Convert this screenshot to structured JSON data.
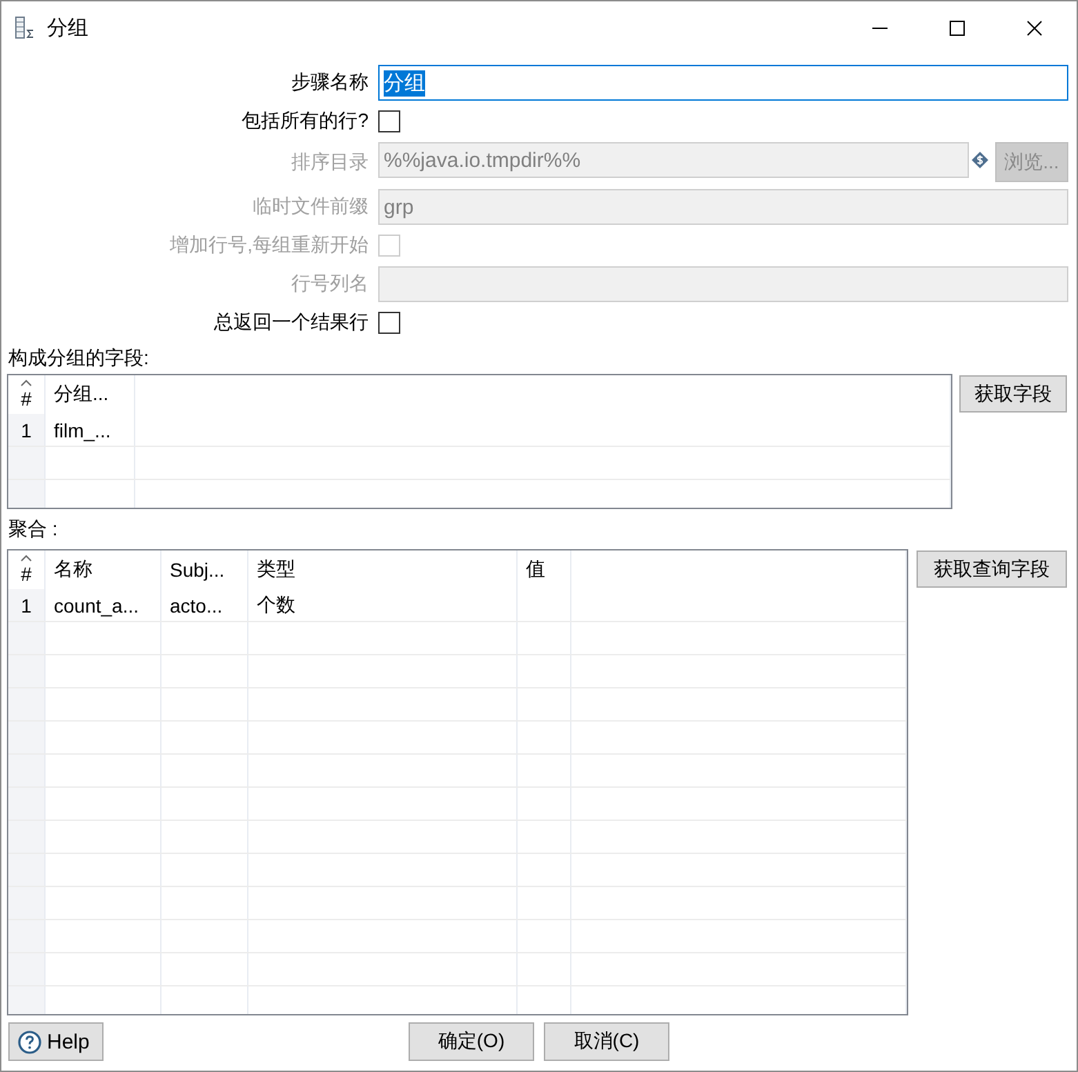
{
  "window": {
    "title": "分组"
  },
  "form": [
    {
      "kind": "text",
      "label": "步骤名称",
      "value": "分组",
      "disabled": false,
      "focused": true
    },
    {
      "kind": "checkbox",
      "label": "包括所有的行?",
      "checked": false,
      "disabled": false,
      "focused": false
    },
    {
      "kind": "text-browse",
      "label": "排序目录",
      "value": "%%java.io.tmpdir%%",
      "button": "浏览...",
      "disabled": true,
      "focused": false
    },
    {
      "kind": "text",
      "label": "临时文件前缀",
      "value": "grp",
      "disabled": true,
      "focused": false
    },
    {
      "kind": "checkbox",
      "label": "增加行号,每组重新开始",
      "checked": false,
      "disabled": true,
      "focused": false
    },
    {
      "kind": "text",
      "label": "行号列名",
      "disabled": true,
      "focused": false
    },
    {
      "kind": "checkbox",
      "label": "总返回一个结果行",
      "checked": false,
      "disabled": false,
      "focused": false
    }
  ],
  "group_fields": {
    "label": "构成分组的字段:",
    "columns": [
      "#",
      "分组..."
    ],
    "rows": [
      [
        "1",
        "film_..."
      ]
    ],
    "button": "获取字段"
  },
  "aggregates": {
    "label": "聚合 :",
    "columns": [
      "#",
      "名称",
      "Subj...",
      "类型",
      "值"
    ],
    "rows": [
      [
        "1",
        "count_a...",
        "acto...",
        "个数"
      ]
    ],
    "button": "获取查询字段"
  },
  "footer": {
    "help": "Help",
    "buttons": [
      "确定(O)",
      "取消(C)"
    ]
  }
}
